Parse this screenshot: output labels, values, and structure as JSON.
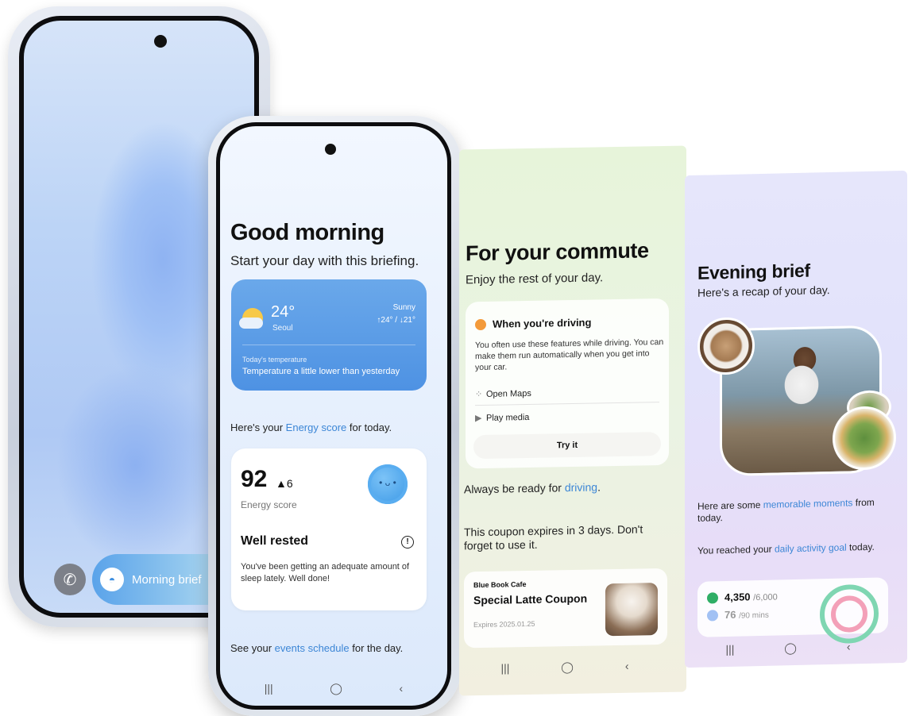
{
  "phone1": {
    "lock_pill_label": "Morning brief",
    "call_icon": "phone-icon",
    "brief_icon": "sunrise-icon"
  },
  "phone2": {
    "greeting": "Good morning",
    "subtitle": "Start your day with this briefing.",
    "weather": {
      "temperature": "24°",
      "city": "Seoul",
      "condition": "Sunny",
      "range": "↑24° / ↓21°",
      "label": "Today's temperature",
      "message": "Temperature a little lower than yesterday"
    },
    "energy_intro_prefix": "Here's your ",
    "energy_intro_link": "Energy score",
    "energy_intro_suffix": " for today.",
    "energy": {
      "score": "92",
      "delta": "▲6",
      "label": "Energy score",
      "status": "Well rested",
      "description": "You've been getting an adequate amount of sleep lately. Well done!"
    },
    "events_prefix": "See your ",
    "events_link": "events schedule",
    "events_suffix": " for the day.",
    "nav": [
      "|||",
      "◯",
      "‹"
    ]
  },
  "commute": {
    "title": "For your commute",
    "subtitle": "Enjoy the rest of your day.",
    "driving": {
      "title": "When you're driving",
      "description": "You often use these features while driving. You can make them run automatically when you get into your car.",
      "items": [
        "Open Maps",
        "Play media"
      ],
      "button": "Try it"
    },
    "ready_prefix": "Always be ready for ",
    "ready_link": "driving",
    "ready_suffix": ".",
    "coupon_message": "This coupon expires in 3 days. Don't forget to use it.",
    "coupon": {
      "store": "Blue Book Cafe",
      "name": "Special Latte Coupon",
      "expires": "Expires 2025.01.25"
    },
    "nav": [
      "|||",
      "◯",
      "‹"
    ]
  },
  "evening": {
    "title": "Evening brief",
    "subtitle": "Here's a recap of your day.",
    "moments_prefix": "Here are some ",
    "moments_link": "memorable moments",
    "moments_suffix": " from today.",
    "goal_prefix": "You reached your ",
    "goal_link": "daily activity goal",
    "goal_suffix": " today.",
    "steps": "4,350",
    "steps_goal": "/6,000",
    "mins": "76",
    "mins_goal": "/90 mins",
    "nav": [
      "|||",
      "◯",
      "‹"
    ]
  },
  "colors": {
    "accent_link": "#3c86d6",
    "weather_card": "#4e92e3",
    "commute_bg": "#e7f4da",
    "evening_bg": "#e4e3fb"
  }
}
